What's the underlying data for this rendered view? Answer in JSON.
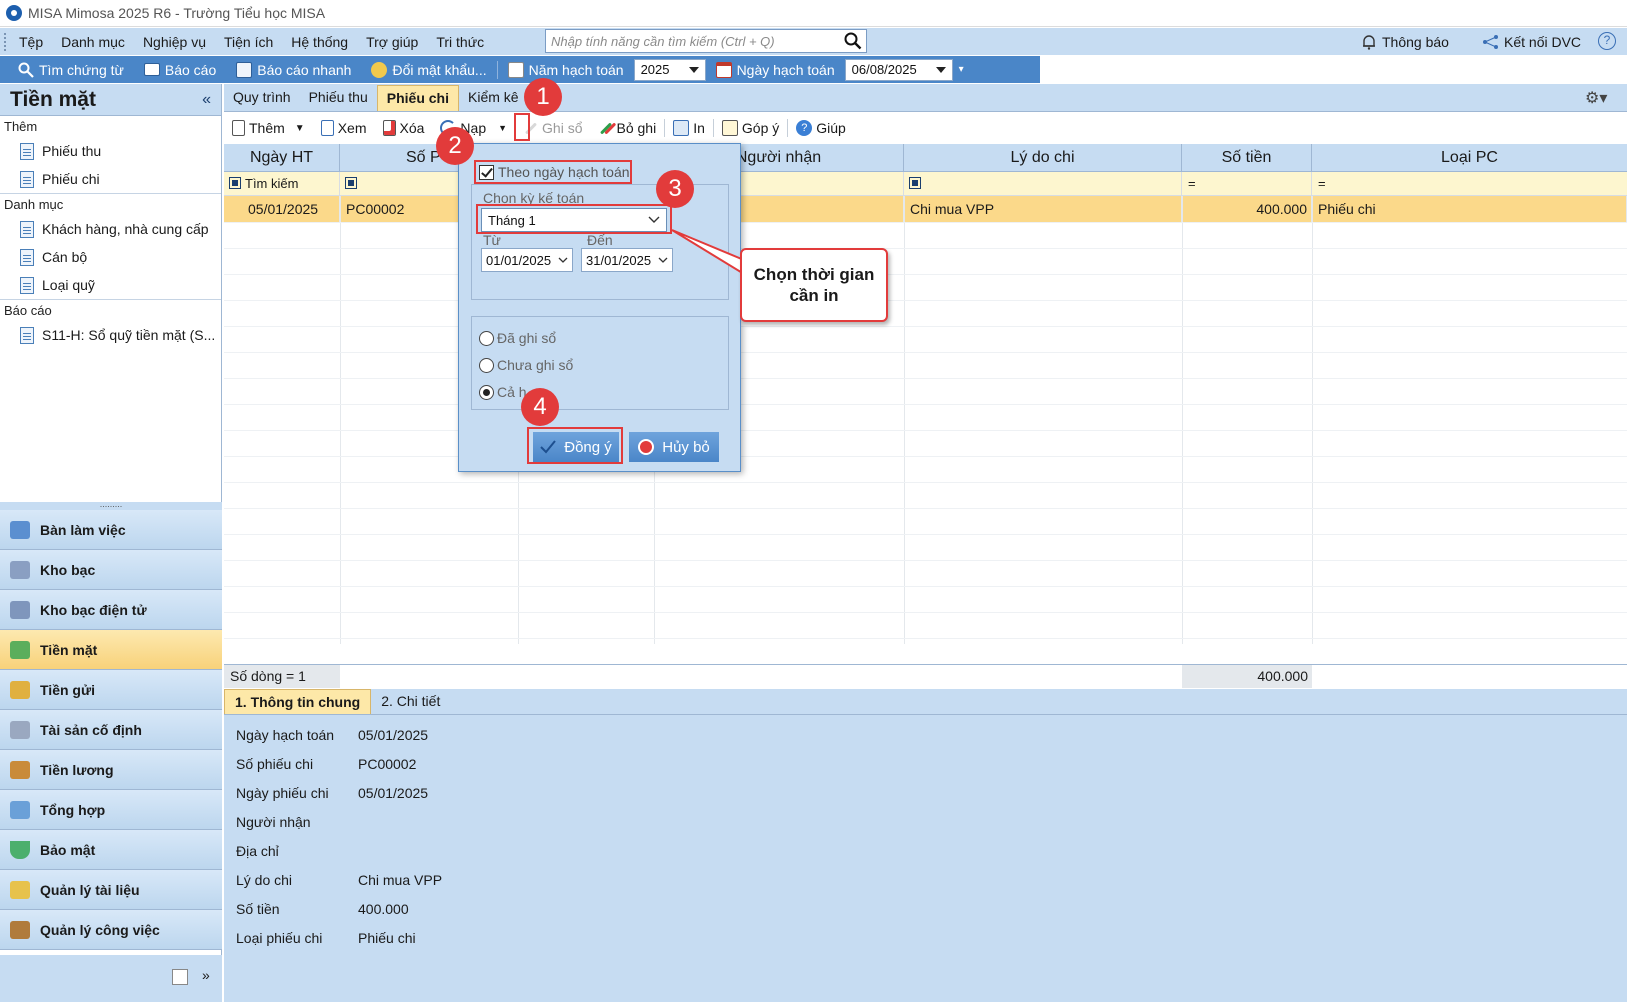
{
  "window": {
    "title": "MISA Mimosa 2025 R6 - Trường Tiểu học MISA"
  },
  "menu": [
    "Tệp",
    "Danh mục",
    "Nghiệp vụ",
    "Tiện ích",
    "Hệ thống",
    "Trợ giúp",
    "Tri thức"
  ],
  "search": {
    "placeholder": "Nhập tính năng cần tìm kiếm (Ctrl + Q)"
  },
  "topright": {
    "notify": "Thông báo",
    "dvc": "Kết nối DVC",
    "help": "?"
  },
  "toolbar2": {
    "find": "Tìm chứng từ",
    "report": "Báo cáo",
    "quick_report": "Báo cáo nhanh",
    "change_password": "Đổi mật khẩu...",
    "fiscal_year_label": "Năm hạch toán",
    "fiscal_year": "2025",
    "posting_date_label": "Ngày hạch toán",
    "posting_date": "06/08/2025"
  },
  "left": {
    "title": "Tiền mặt",
    "collapse": "«",
    "groups": [
      {
        "name": "Thêm",
        "items": [
          "Phiếu thu",
          "Phiếu chi"
        ]
      },
      {
        "name": "Danh mục",
        "items": [
          "Khách hàng, nhà cung cấp",
          "Cán bộ",
          "Loại quỹ"
        ]
      },
      {
        "name": "Báo cáo",
        "items": [
          "S11-H: Sổ quỹ tiền mặt (S..."
        ]
      }
    ],
    "nav": [
      "Bàn làm việc",
      "Kho bạc",
      "Kho bạc điện tử",
      "Tiền mặt",
      "Tiền gửi",
      "Tài sản cố định",
      "Tiền lương",
      "Tổng hợp",
      "Bảo mật",
      "Quản lý tài liệu",
      "Quản lý công việc"
    ],
    "nav_active": "Tiền mặt",
    "divider_dots": "........."
  },
  "tabs": [
    "Quy trình",
    "Phiếu thu",
    "Phiếu chi",
    "Kiểm kê"
  ],
  "active_tab": "Phiếu chi",
  "actions": {
    "add": "Thêm",
    "view": "Xem",
    "delete": "Xóa",
    "load": "Nạp",
    "post": "Ghi sổ",
    "unpost": "Bỏ ghi",
    "print": "In",
    "feedback": "Góp ý",
    "help": "Giúp"
  },
  "grid": {
    "headers": [
      "Ngày HT",
      "Số PC",
      "",
      "Người nhận",
      "Lý do chi",
      "Số tiền",
      "Loại PC"
    ],
    "header_sopc_visible": "Số P",
    "filter_label": "Tìm kiếm",
    "filter_eq": "=",
    "rows": [
      {
        "date": "05/01/2025",
        "number": "PC00002",
        "recipient": "",
        "reason": "Chi mua VPP",
        "amount": "400.000",
        "type": "Phiếu chi"
      }
    ],
    "row_count": "Số dòng = 1",
    "total": "400.000"
  },
  "detail": {
    "tabs": [
      "1. Thông tin chung",
      "2. Chi tiết"
    ],
    "fields": [
      {
        "label": "Ngày hạch toán",
        "value": "05/01/2025"
      },
      {
        "label": "Số phiếu chi",
        "value": "PC00002"
      },
      {
        "label": "Ngày phiếu chi",
        "value": "05/01/2025"
      },
      {
        "label": "Người nhận",
        "value": ""
      },
      {
        "label": "Địa chỉ",
        "value": ""
      },
      {
        "label": "Lý do chi",
        "value": "Chi mua VPP"
      },
      {
        "label": "Số tiền",
        "value": "400.000"
      },
      {
        "label": "Loại phiếu chi",
        "value": "Phiếu chi"
      }
    ]
  },
  "popup": {
    "by_posting_date": "Theo ngày hạch toán",
    "period_label": "Chọn kỳ kế toán",
    "period": "Tháng 1",
    "from_label": "Từ",
    "to_label": "Đến",
    "from": "01/01/2025",
    "to": "31/01/2025",
    "radio_posted": "Đã ghi sổ",
    "radio_unposted": "Chưa ghi sổ",
    "radio_all": "Cả h",
    "ok": "Đồng ý",
    "cancel": "Hủy bỏ"
  },
  "annotations": {
    "steps": [
      "1",
      "2",
      "3",
      "4"
    ],
    "callout": "Chọn thời gian cần in"
  },
  "colors": {
    "accent": "#4a86c8",
    "panel": "#c6dcf2",
    "highlight": "#fbd98a",
    "annotation": "#e23b3b"
  }
}
